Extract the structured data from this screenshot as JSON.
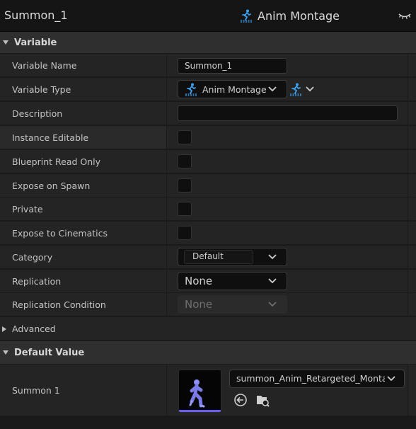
{
  "title_bar": {
    "variable_name": "Summon_1",
    "variable_type": "Anim Montage",
    "type_icon": "anim-montage-icon",
    "visibility_icon": "eye-closed-icon"
  },
  "sections": {
    "variable": "Variable",
    "advanced": "Advanced",
    "default_value": "Default Value"
  },
  "properties": {
    "variable_name": {
      "label": "Variable Name",
      "value": "Summon_1"
    },
    "variable_type": {
      "label": "Variable Type",
      "value": "Anim Montage"
    },
    "description": {
      "label": "Description",
      "value": ""
    },
    "instance_editable": {
      "label": "Instance Editable",
      "checked": false
    },
    "blueprint_read_only": {
      "label": "Blueprint Read Only",
      "checked": false
    },
    "expose_on_spawn": {
      "label": "Expose on Spawn",
      "checked": false
    },
    "private": {
      "label": "Private",
      "checked": false
    },
    "expose_to_cinematics": {
      "label": "Expose to Cinematics",
      "checked": false
    },
    "category": {
      "label": "Category",
      "value": "Default"
    },
    "replication": {
      "label": "Replication",
      "value": "None"
    },
    "replication_condition": {
      "label": "Replication Condition",
      "value": "None",
      "disabled": true
    }
  },
  "default_value": {
    "label": "Summon 1",
    "asset": "summon_Anim_Retargeted_Montage",
    "thumbnail_icon": "running-character-icon",
    "accent_color": "#6b5cf2"
  },
  "colors": {
    "type_icon": "#3aa0f0",
    "background": "#1a1a1a",
    "row": "#242424",
    "section_header": "#2f2f2f"
  }
}
